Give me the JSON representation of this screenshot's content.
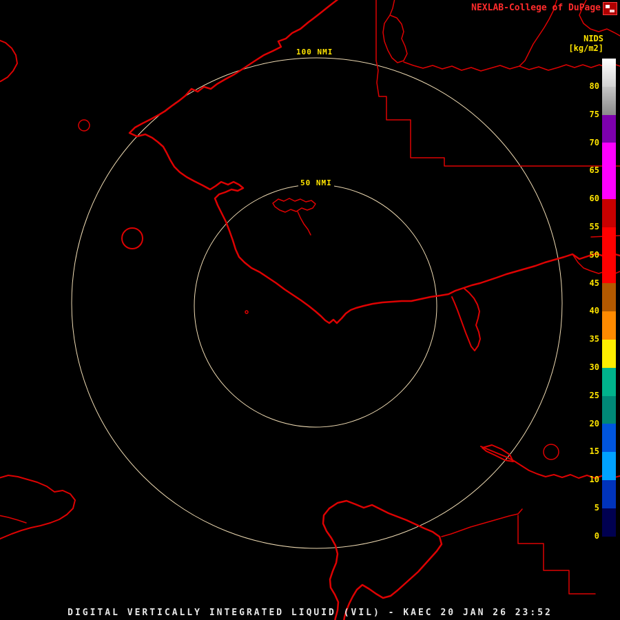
{
  "header": {
    "branding": "NEXLAB-College of DuPage",
    "logo_icon": "cod-logo-icon"
  },
  "colorbar": {
    "title": "NIDS",
    "units": "[kg/m2]",
    "ticks": [
      "80",
      "75",
      "70",
      "65",
      "60",
      "55",
      "50",
      "45",
      "40",
      "35",
      "30",
      "25",
      "20",
      "15",
      "10",
      "5",
      "0"
    ],
    "segments": [
      {
        "from": 80,
        "to": 85,
        "color": "#ffffff",
        "color2": "#d2d2d2"
      },
      {
        "from": 75,
        "to": 80,
        "color": "#c6c6c6",
        "color2": "#8a8a8a"
      },
      {
        "from": 70,
        "to": 75,
        "color": "#7d00ad"
      },
      {
        "from": 60,
        "to": 70,
        "color": "#ff00ff"
      },
      {
        "from": 55,
        "to": 60,
        "color": "#c80000"
      },
      {
        "from": 45,
        "to": 55,
        "color": "#ff0000"
      },
      {
        "from": 40,
        "to": 45,
        "color": "#b35900"
      },
      {
        "from": 35,
        "to": 40,
        "color": "#ff8a00"
      },
      {
        "from": 30,
        "to": 35,
        "color": "#ffee00"
      },
      {
        "from": 25,
        "to": 30,
        "color": "#00b38c"
      },
      {
        "from": 20,
        "to": 25,
        "color": "#008877"
      },
      {
        "from": 15,
        "to": 20,
        "color": "#0055dd"
      },
      {
        "from": 10,
        "to": 15,
        "color": "#00a2ff"
      },
      {
        "from": 5,
        "to": 10,
        "color": "#0033bb"
      },
      {
        "from": 0,
        "to": 5,
        "color": "#000050"
      },
      {
        "from": -1.5,
        "to": 0,
        "color": "#000000"
      }
    ]
  },
  "map": {
    "ring_labels": {
      "outer": "100 NMI",
      "inner": "50 NMI"
    },
    "ring_color": "#f0dcb4",
    "outline_color": "#dd0202",
    "background": "#000000"
  },
  "footer": {
    "title": "DIGITAL VERTICALLY INTEGRATED LIQUID (VIL) - KAEC 20 JAN 26 23:52"
  }
}
